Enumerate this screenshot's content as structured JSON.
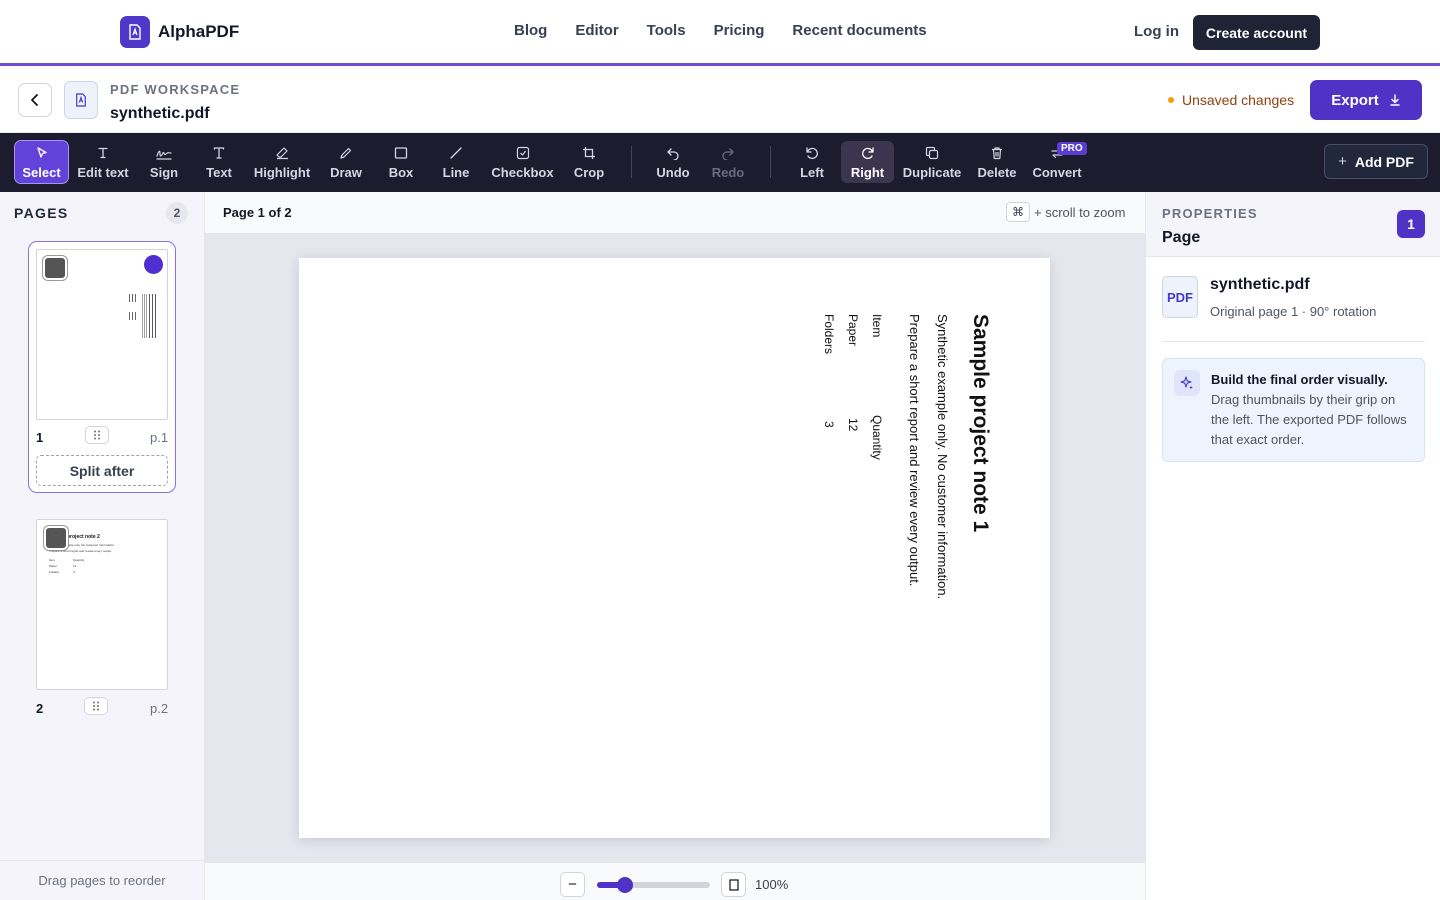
{
  "brand": {
    "name": "AlphaPDF"
  },
  "nav": {
    "links": [
      "Blog",
      "Editor",
      "Tools",
      "Pricing",
      "Recent documents"
    ],
    "login": "Log in",
    "create_account": "Create account"
  },
  "workspace": {
    "label": "PDF WORKSPACE",
    "file_name": "synthetic.pdf",
    "status": "Unsaved changes",
    "export_label": "Export"
  },
  "toolbar": {
    "tools": {
      "select": "Select",
      "edit_text": "Edit text",
      "sign": "Sign",
      "text": "Text",
      "highlight": "Highlight",
      "draw": "Draw",
      "box": "Box",
      "line": "Line",
      "checkbox": "Checkbox",
      "crop": "Crop",
      "undo": "Undo",
      "redo": "Redo",
      "left": "Left",
      "right": "Right",
      "duplicate": "Duplicate",
      "delete": "Delete",
      "convert": "Convert"
    },
    "pro_badge": "PRO",
    "add_pdf": "Add PDF",
    "active_tool": "Select",
    "disabled": [
      "Redo"
    ]
  },
  "pages_panel": {
    "title": "PAGES",
    "count": "2",
    "pages": [
      {
        "number": "1",
        "label": "p.1",
        "selected": true
      },
      {
        "number": "2",
        "label": "p.2",
        "selected": false
      }
    ],
    "split_after": "Split after",
    "footer_hint": "Drag pages to reorder"
  },
  "viewer": {
    "page_indicator": "Page 1 of 2",
    "zoom_key": "⌘",
    "zoom_hint": "+ scroll to zoom",
    "zoom_value": "100%",
    "zoom_fraction": 0.25
  },
  "document_page": {
    "rotation_degrees": 90,
    "title": "Sample project note 1",
    "line1": "Synthetic example only. No customer information.",
    "line2": "Prepare a short report and review every output.",
    "table": {
      "headers": [
        "Item",
        "Quantity"
      ],
      "rows": [
        [
          "Paper",
          "12"
        ],
        [
          "Folders",
          "3"
        ]
      ]
    }
  },
  "thumb2": {
    "title": "project note 2",
    "line1": "Synthetic example only. No customer information.",
    "line2": "Prepare a short report and review every output.",
    "headers": [
      "Item",
      "Quantity"
    ],
    "rows": [
      [
        "Paper",
        "12"
      ],
      [
        "Folders",
        "3"
      ]
    ]
  },
  "properties": {
    "label": "PROPERTIES",
    "title": "Page",
    "badge": "1",
    "file_icon_text": "PDF",
    "file_name": "synthetic.pdf",
    "meta": "Original page 1 · 90° rotation",
    "tip_title": "Build the final order visually.",
    "tip_body": "Drag thumbnails by their grip on the left. The exported PDF follows that exact order."
  },
  "colors": {
    "accent": "#5132c7",
    "toolbar_bg": "#1d1b2e",
    "warning_dot": "#f59e0b"
  }
}
